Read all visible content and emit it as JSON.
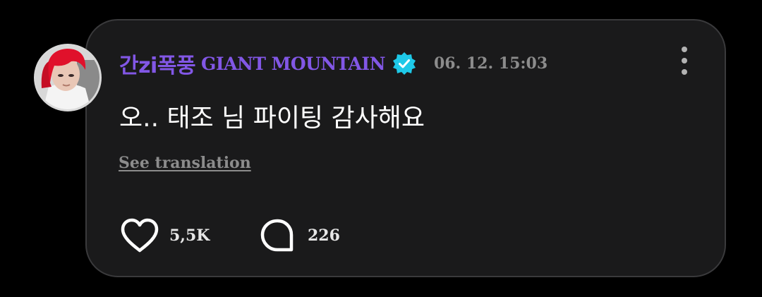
{
  "comment": {
    "author": "간zi폭풍",
    "channel": "GIANT MOUNTAIN",
    "verified_icon": "verified-badge-icon",
    "timestamp": "06. 12. 15:03",
    "text": "오.. 태조 님 파이팅 감사해요",
    "translate_label": "See translation",
    "likes": "5,5K",
    "replies": "226"
  },
  "icons": {
    "more": "more-vertical-icon",
    "like": "heart-icon",
    "reply": "speech-bubble-icon"
  },
  "colors": {
    "background": "#000000",
    "card": "#1a1a1b",
    "card_border": "#3a3a3c",
    "author": "#8257e6",
    "verified": "#1ec9e8",
    "muted": "#8c8c8c",
    "text": "#ffffff"
  }
}
